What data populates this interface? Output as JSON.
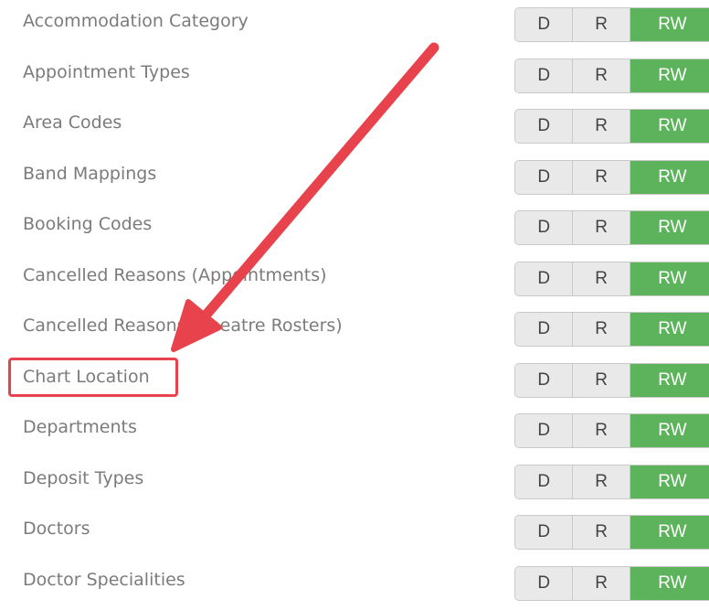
{
  "permissions": {
    "option_d": "D",
    "option_r": "R",
    "option_rw": "RW",
    "selected": "RW",
    "selected_color": "#5cb35c",
    "rows": [
      {
        "label": "Accommodation Category"
      },
      {
        "label": "Appointment Types"
      },
      {
        "label": "Area Codes"
      },
      {
        "label": "Band Mappings"
      },
      {
        "label": "Booking Codes"
      },
      {
        "label": "Cancelled Reasons (Appointments)"
      },
      {
        "label": "Cancelled Reasons (Theatre Rosters)"
      },
      {
        "label": "Chart Location"
      },
      {
        "label": "Departments"
      },
      {
        "label": "Deposit Types"
      },
      {
        "label": "Doctors"
      },
      {
        "label": "Doctor Specialities"
      }
    ]
  },
  "annotation": {
    "highlighted_item": "Chart Location",
    "color": "#e8434c"
  }
}
